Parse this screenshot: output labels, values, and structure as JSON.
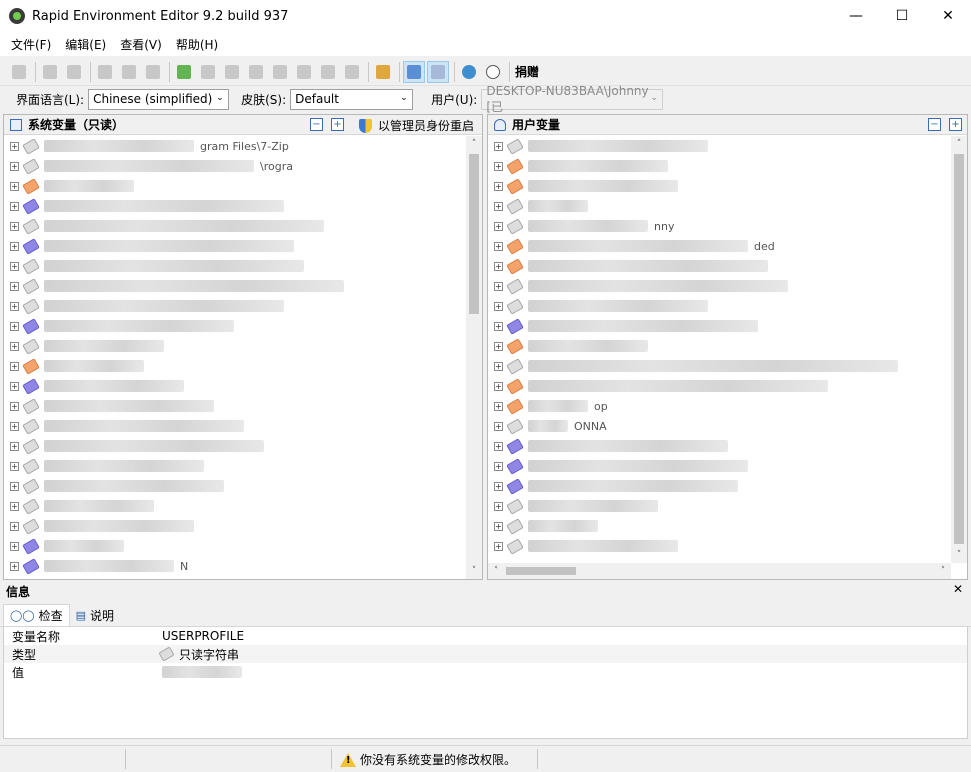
{
  "window": {
    "title": "Rapid Environment Editor 9.2 build 937"
  },
  "menu": [
    "文件(F)",
    "编辑(E)",
    "查看(V)",
    "帮助(H)"
  ],
  "toolbar": {
    "donate_label": "捐赠"
  },
  "options": {
    "language_label": "界面语言(L):",
    "language_value": "Chinese (simplified)",
    "skin_label": "皮肤(S):",
    "skin_value": "Default",
    "user_label": "用户(U):",
    "user_value": "DESKTOP-NU83BAA\\Johnny [已"
  },
  "system_panel": {
    "title": "系统变量（只读）",
    "admin_restart_label": "以管理员身份重启",
    "rows": [
      {
        "icon": "gray",
        "text": "gram Files\\7-Zip"
      },
      {
        "icon": "gray",
        "text": "\\rogra"
      },
      {
        "icon": "orange",
        "text": ""
      },
      {
        "icon": "purple",
        "text": ""
      },
      {
        "icon": "gray",
        "text": ""
      },
      {
        "icon": "purple",
        "text": ""
      },
      {
        "icon": "gray",
        "text": ""
      },
      {
        "icon": "gray",
        "text": ""
      },
      {
        "icon": "gray",
        "text": ""
      },
      {
        "icon": "purple",
        "text": ""
      },
      {
        "icon": "gray",
        "text": ""
      },
      {
        "icon": "orange",
        "text": ""
      },
      {
        "icon": "purple",
        "text": ""
      },
      {
        "icon": "gray",
        "text": ""
      },
      {
        "icon": "gray",
        "text": ""
      },
      {
        "icon": "gray",
        "text": ""
      },
      {
        "icon": "gray",
        "text": ""
      },
      {
        "icon": "gray",
        "text": ""
      },
      {
        "icon": "gray",
        "text": ""
      },
      {
        "icon": "gray",
        "text": ""
      },
      {
        "icon": "purple",
        "text": ""
      },
      {
        "icon": "purple",
        "text": "N"
      }
    ]
  },
  "user_panel": {
    "title": "用户变量",
    "rows": [
      {
        "icon": "gray",
        "text": ""
      },
      {
        "icon": "orange",
        "text": ""
      },
      {
        "icon": "orange",
        "text": ""
      },
      {
        "icon": "gray",
        "text": ""
      },
      {
        "icon": "gray",
        "text": "nny"
      },
      {
        "icon": "orange",
        "text": "ded"
      },
      {
        "icon": "orange",
        "text": ""
      },
      {
        "icon": "gray",
        "text": ""
      },
      {
        "icon": "gray",
        "text": ""
      },
      {
        "icon": "purple",
        "text": ""
      },
      {
        "icon": "orange",
        "text": ""
      },
      {
        "icon": "gray",
        "text": ""
      },
      {
        "icon": "orange",
        "text": ""
      },
      {
        "icon": "orange",
        "text": "op"
      },
      {
        "icon": "gray",
        "text": "ONNA"
      },
      {
        "icon": "purple",
        "text": ""
      },
      {
        "icon": "purple",
        "text": ""
      },
      {
        "icon": "purple",
        "text": ""
      },
      {
        "icon": "gray",
        "text": ""
      },
      {
        "icon": "gray",
        "text": ""
      },
      {
        "icon": "gray",
        "text": ""
      }
    ]
  },
  "info": {
    "title": "信息",
    "tabs": [
      "检查",
      "说明"
    ],
    "rows": [
      {
        "key": "变量名称",
        "value": "USERPROFILE"
      },
      {
        "key": "类型",
        "value": "只读字符串"
      },
      {
        "key": "值",
        "value": ""
      }
    ]
  },
  "status": {
    "message": "你没有系统变量的修改权限。"
  }
}
